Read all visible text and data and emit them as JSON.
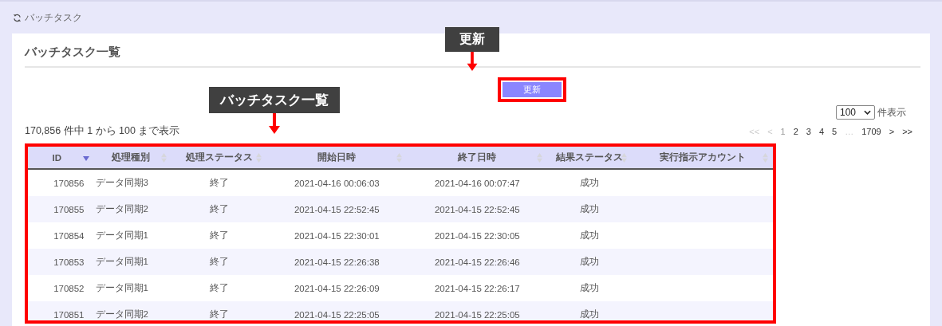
{
  "breadcrumb": {
    "label": "バッチタスク"
  },
  "panel": {
    "title": "バッチタスク一覧"
  },
  "refresh_button": {
    "label": "更新"
  },
  "page_size": {
    "value": "100",
    "suffix": "件表示"
  },
  "summary": "170,856 件中 1 から 100 まで表示",
  "pagination": [
    {
      "label": "<<",
      "disabled": true,
      "selected": false
    },
    {
      "label": "<",
      "disabled": true,
      "selected": false
    },
    {
      "label": "1",
      "disabled": false,
      "selected": true
    },
    {
      "label": "2",
      "disabled": false,
      "selected": false
    },
    {
      "label": "3",
      "disabled": false,
      "selected": false
    },
    {
      "label": "4",
      "disabled": false,
      "selected": false
    },
    {
      "label": "5",
      "disabled": false,
      "selected": false
    },
    {
      "label": "…",
      "disabled": true,
      "selected": false
    },
    {
      "label": "1709",
      "disabled": false,
      "selected": false
    },
    {
      "label": ">",
      "disabled": false,
      "selected": false
    },
    {
      "label": ">>",
      "disabled": false,
      "selected": false
    }
  ],
  "table": {
    "columns": [
      {
        "label": "ID",
        "sorted": true
      },
      {
        "label": "処理種別",
        "sorted": false
      },
      {
        "label": "処理ステータス",
        "sorted": false
      },
      {
        "label": "開始日時",
        "sorted": false
      },
      {
        "label": "終了日時",
        "sorted": false
      },
      {
        "label": "結果ステータス",
        "sorted": false
      },
      {
        "label": "実行指示アカウント",
        "sorted": false
      }
    ],
    "rows": [
      [
        "170856",
        "データ同期3",
        "終了",
        "2021-04-16 00:06:03",
        "2021-04-16 00:07:47",
        "成功",
        ""
      ],
      [
        "170855",
        "データ同期2",
        "終了",
        "2021-04-15 22:52:45",
        "2021-04-15 22:52:45",
        "成功",
        ""
      ],
      [
        "170854",
        "データ同期1",
        "終了",
        "2021-04-15 22:30:01",
        "2021-04-15 22:30:05",
        "成功",
        ""
      ],
      [
        "170853",
        "データ同期1",
        "終了",
        "2021-04-15 22:26:38",
        "2021-04-15 22:26:46",
        "成功",
        ""
      ],
      [
        "170852",
        "データ同期1",
        "終了",
        "2021-04-15 22:26:09",
        "2021-04-15 22:26:17",
        "成功",
        ""
      ],
      [
        "170851",
        "データ同期2",
        "終了",
        "2021-04-15 22:25:05",
        "2021-04-15 22:25:05",
        "成功",
        ""
      ]
    ]
  },
  "annotations": [
    {
      "kind": "button",
      "label": "更新"
    },
    {
      "kind": "table",
      "label": "バッチタスク一覧"
    }
  ]
}
